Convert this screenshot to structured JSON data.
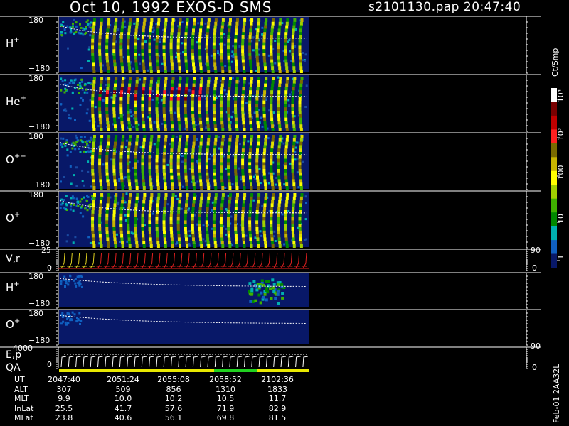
{
  "header": {
    "title": "Oct 10, 1992    EXOS-D SMS",
    "file": "s2101130.pap  20:47:40"
  },
  "colorbar": {
    "label": "Ct/Smp",
    "ticks": [
      "10⁴",
      "10³",
      "100",
      "10",
      "1"
    ],
    "colors": [
      "#ffffff",
      "#7a0000",
      "#c00000",
      "#ff2020",
      "#7a6a00",
      "#c8b400",
      "#ffff00",
      "#a0d000",
      "#40b000",
      "#008800",
      "#00b0b0",
      "#1060c0",
      "#081868"
    ]
  },
  "side_date": "Feb-01 2AA32L",
  "colors": {
    "background": "#000000",
    "no_data": "#081868",
    "trace": "#ffffff",
    "velocity_red": "#e02020",
    "velocity_yellow": "#e0d020",
    "qa_yellow": "#e8e800",
    "qa_green": "#20d020"
  },
  "panels": [
    {
      "label": "H",
      "charge": "+",
      "ymax": "180",
      "ymin": "−180"
    },
    {
      "label": "He",
      "charge": "+",
      "ymax": "180",
      "ymin": "−180"
    },
    {
      "label": "O",
      "charge": "++",
      "ymax": "180",
      "ymin": "−180"
    },
    {
      "label": "O",
      "charge": "+",
      "ymax": "180",
      "ymin": "−180"
    }
  ],
  "vr_panel": {
    "label": "V,r",
    "ymax": "25",
    "ymin": "0",
    "right_max": "90",
    "right_min": "0"
  },
  "low_panels": [
    {
      "label": "H",
      "charge": "+",
      "ymax": "180",
      "ymin": "−180"
    },
    {
      "label": "O",
      "charge": "+",
      "ymax": "180",
      "ymin": "−180"
    }
  ],
  "ep_panel": {
    "label1": "E,p",
    "label2": "QA",
    "ymax": "4000",
    "ymin": "0",
    "right_max": "90",
    "right_min": "0"
  },
  "orbit": {
    "rows": [
      {
        "name": "UT",
        "values": [
          "2047:40",
          "2051:24",
          "2055:08",
          "2058:52",
          "2102:36"
        ]
      },
      {
        "name": "ALT",
        "values": [
          "307",
          "509",
          "856",
          "1310",
          "1833"
        ]
      },
      {
        "name": "MLT",
        "values": [
          "9.9",
          "10.0",
          "10.2",
          "10.5",
          "11.7"
        ]
      },
      {
        "name": "InLat",
        "values": [
          "25.5",
          "41.7",
          "57.6",
          "71.9",
          "82.9"
        ]
      },
      {
        "name": "MLat",
        "values": [
          "23.8",
          "40.6",
          "56.1",
          "69.8",
          "81.5"
        ]
      }
    ]
  },
  "chart_data": {
    "type": "heatmap",
    "x_ticks": [
      "2047:40",
      "2051:24",
      "2055:08",
      "2058:52",
      "2102:36"
    ],
    "ylim": [
      -180,
      180
    ],
    "colorbar_range": [
      1,
      10000
    ],
    "colorbar_scale": "log",
    "series": [
      {
        "name": "H+",
        "data_start": "2047:40",
        "spin_bands_start": "2049:00",
        "spin_band_count": 30
      },
      {
        "name": "He+",
        "data_start": "2047:40",
        "spin_bands_start": "2049:00",
        "spin_band_count": 30
      },
      {
        "name": "O++",
        "data_start": "2047:40",
        "spin_bands_start": "2049:00",
        "spin_band_count": 30
      },
      {
        "name": "O+",
        "data_start": "2047:40",
        "spin_bands_start": "2049:00",
        "spin_band_count": 30
      }
    ]
  }
}
